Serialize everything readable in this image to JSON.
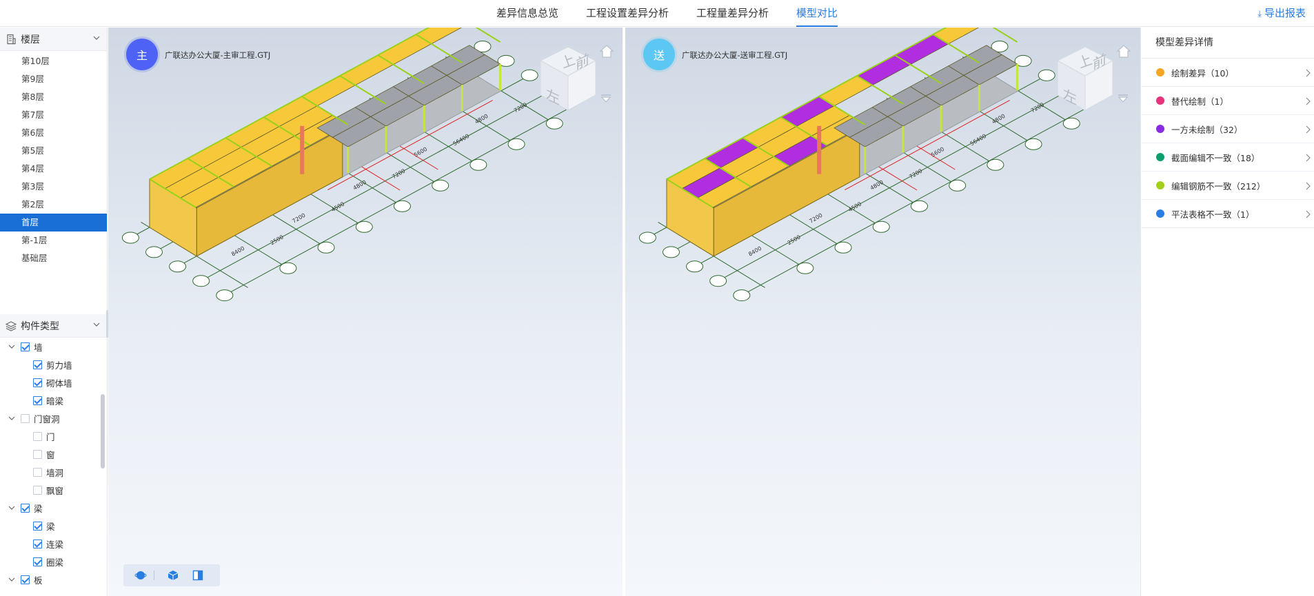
{
  "tabs": [
    "差异信息总览",
    "工程设置差异分析",
    "工程量差异分析",
    "模型对比"
  ],
  "active_tab": "模型对比",
  "export_label": "导出报表",
  "floor_panel": {
    "title": "楼层",
    "floors": [
      "第10层",
      "第9层",
      "第8层",
      "第7层",
      "第6层",
      "第5层",
      "第4层",
      "第3层",
      "第2层",
      "首层",
      "第-1层",
      "基础层"
    ],
    "selected": "首层"
  },
  "component_panel": {
    "title": "构件类型",
    "tree": [
      {
        "label": "墙",
        "level": 0,
        "checked": true,
        "expanded": true
      },
      {
        "label": "剪力墙",
        "level": 1,
        "checked": true
      },
      {
        "label": "砌体墙",
        "level": 1,
        "checked": true
      },
      {
        "label": "暗梁",
        "level": 1,
        "checked": true
      },
      {
        "label": "门窗洞",
        "level": 0,
        "checked": false,
        "expanded": true
      },
      {
        "label": "门",
        "level": 1,
        "checked": false
      },
      {
        "label": "窗",
        "level": 1,
        "checked": false
      },
      {
        "label": "墙洞",
        "level": 1,
        "checked": false
      },
      {
        "label": "飘窗",
        "level": 1,
        "checked": false
      },
      {
        "label": "梁",
        "level": 0,
        "checked": true,
        "expanded": true
      },
      {
        "label": "梁",
        "level": 1,
        "checked": true
      },
      {
        "label": "连梁",
        "level": 1,
        "checked": true
      },
      {
        "label": "圈梁",
        "level": 1,
        "checked": true
      },
      {
        "label": "板",
        "level": 0,
        "checked": true,
        "expanded": true
      }
    ]
  },
  "viewports": [
    {
      "badge": "主",
      "title": "广联达办公大厦-主审工程.GTJ",
      "badge_color": "#4e63f5",
      "highlight": false
    },
    {
      "badge": "送",
      "title": "广联达办公大厦-送审工程.GTJ",
      "badge_color": "#5cc7f2",
      "highlight": true
    }
  ],
  "viewcube": {
    "top": "上",
    "left": "左",
    "front": "前"
  },
  "axis_labels": [
    "8400",
    "2500",
    "7200",
    "4500",
    "4800",
    "7200",
    "5600",
    "56400",
    "4800",
    "7200"
  ],
  "diff_panel": {
    "title": "模型差异详情",
    "items": [
      {
        "label": "绘制差异（10）",
        "color": "#f5a623"
      },
      {
        "label": "替代绘制（1）",
        "color": "#e8327c"
      },
      {
        "label": "一方未绘制（32）",
        "color": "#8a2be2"
      },
      {
        "label": "截面编辑不一致（18）",
        "color": "#0e9f6e"
      },
      {
        "label": "编辑钢筋不一致（212）",
        "color": "#a3d11a"
      },
      {
        "label": "平法表格不一致（1）",
        "color": "#2a7de1"
      }
    ]
  }
}
